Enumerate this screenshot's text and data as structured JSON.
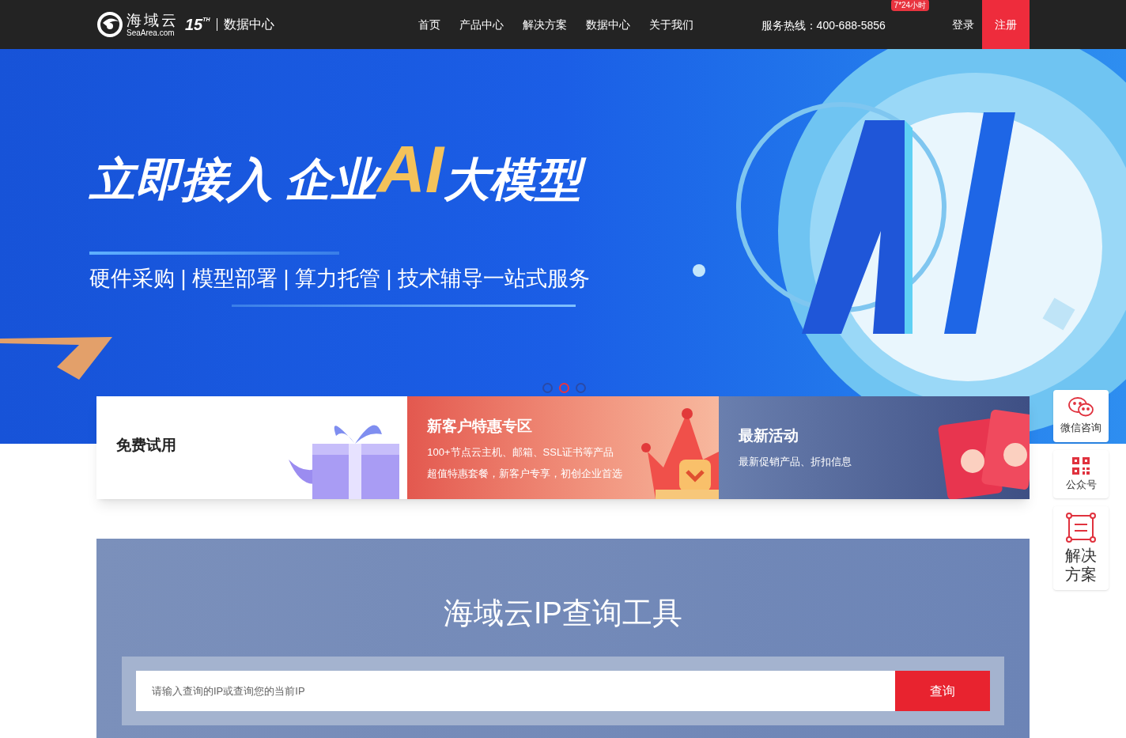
{
  "header": {
    "logo_name": "海域云",
    "logo_domain": "SeaArea.com",
    "anniversary": "15",
    "anniversary_suffix": "TH",
    "section": "数据中心",
    "nav": [
      {
        "label": "首页",
        "selected": false
      },
      {
        "label": "产品中心",
        "selected": false
      },
      {
        "label": "解决方案",
        "selected": false
      },
      {
        "label": "数据中心",
        "selected": false
      },
      {
        "label": "关于我们",
        "selected": false
      }
    ],
    "hotline": "服务热线：400-688-5856",
    "hotline_badge": "7*24小时",
    "login": "登录",
    "register": "注册"
  },
  "banner": {
    "headline_before": "立即接入 企业",
    "headline_highlight": "AI",
    "headline_after": "大模型",
    "subtitle": "硬件采购 | 模型部署 | 算力托管 | 技术辅导一站式服务",
    "dots": [
      {
        "selected": false
      },
      {
        "selected": true
      },
      {
        "selected": false
      }
    ]
  },
  "cards": [
    {
      "kind": "plain",
      "title": "免费试用"
    },
    {
      "kind": "promo",
      "title": "新客户特惠专区",
      "lines": [
        "100+节点云主机、邮箱、SSL证书等产品",
        "超值特惠套餐，新客户专享，初创企业首选"
      ]
    },
    {
      "kind": "event",
      "title": "最新活动",
      "lines": [
        "最新促销产品、折扣信息"
      ]
    }
  ],
  "side": [
    {
      "kind": "chat",
      "label": "微信咨询"
    },
    {
      "kind": "qr",
      "label": "公众号"
    },
    {
      "kind": "doc",
      "label": "解决方案"
    }
  ],
  "ip_tool": {
    "title": "海域云IP查询工具",
    "placeholder": "请输入查询的IP或查询您的当前IP",
    "button": "查询"
  }
}
